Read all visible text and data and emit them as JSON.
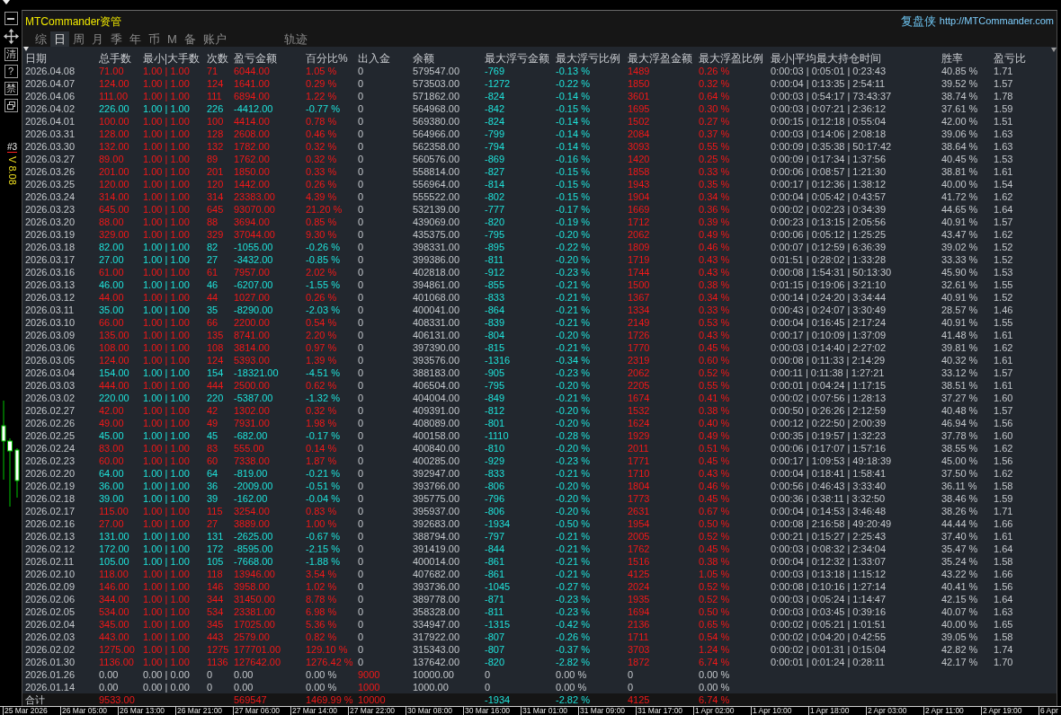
{
  "title": "MTCommander资管",
  "brand": {
    "name": "复盘侠",
    "url": "http://MTCommander.com"
  },
  "toolbar": [
    {
      "kind": "minimize"
    },
    {
      "kind": "move"
    },
    {
      "kind": "text",
      "label": "清"
    },
    {
      "kind": "text",
      "label": "?"
    },
    {
      "kind": "text",
      "label": "禁"
    },
    {
      "kind": "restore"
    }
  ],
  "chart_overlay": {
    "tag": "#3",
    "version": "V 8.08"
  },
  "tabs": [
    {
      "label": "综",
      "selected": false
    },
    {
      "label": "日",
      "selected": true
    },
    {
      "label": "周",
      "selected": false
    },
    {
      "label": "月",
      "selected": false
    },
    {
      "label": "季",
      "selected": false
    },
    {
      "label": "年",
      "selected": false
    },
    {
      "label": "币",
      "selected": false
    },
    {
      "label": "M",
      "selected": false
    },
    {
      "label": "备",
      "selected": false
    },
    {
      "label": "账户",
      "selected": false
    }
  ],
  "trail_button": {
    "label": "轨迹"
  },
  "table": {
    "columns": [
      {
        "label": "日期",
        "kind": "plain"
      },
      {
        "label": "总手数",
        "kind": "outcome"
      },
      {
        "label": "最小|大手数",
        "kind": "outcome"
      },
      {
        "label": "次数",
        "kind": "outcome"
      },
      {
        "label": "盈亏金额",
        "kind": "outcome"
      },
      {
        "label": "百分比%",
        "kind": "outcome"
      },
      {
        "label": "出入金",
        "kind": "cash"
      },
      {
        "label": "余额",
        "kind": "plain"
      },
      {
        "label": "最大浮亏金额",
        "kind": "adverse"
      },
      {
        "label": "最大浮亏比例",
        "kind": "adverse"
      },
      {
        "label": "最大浮盈金额",
        "kind": "favorable"
      },
      {
        "label": "最大浮盈比例",
        "kind": "favorable"
      },
      {
        "label": "最小|平均最大持仓时间",
        "kind": "plain"
      },
      {
        "label": "胜率",
        "kind": "plain"
      },
      {
        "label": "盈亏比",
        "kind": "plain"
      }
    ],
    "rows": [
      {
        "kind": "profit",
        "cash_flow": false,
        "cells": [
          "2026.04.08",
          "71.00",
          "1.00 | 1.00",
          "71",
          "6044.00",
          "1.05 %",
          "0",
          "579547.00",
          "-769",
          "-0.13 %",
          "1489",
          "0.26 %",
          "0:00:03 | 0:05:01 | 0:23:43",
          "40.85 %",
          "1.71"
        ]
      },
      {
        "kind": "profit",
        "cash_flow": false,
        "cells": [
          "2026.04.07",
          "124.00",
          "1.00 | 1.00",
          "124",
          "1641.00",
          "0.29 %",
          "0",
          "573503.00",
          "-1272",
          "-0.22 %",
          "1850",
          "0.32 %",
          "0:00:04 | 0:13:35 | 2:54:11",
          "39.52 %",
          "1.57"
        ]
      },
      {
        "kind": "profit",
        "cash_flow": false,
        "cells": [
          "2026.04.06",
          "111.00",
          "1.00 | 1.00",
          "111",
          "6894.00",
          "1.22 %",
          "0",
          "571862.00",
          "-824",
          "-0.14 %",
          "3601",
          "0.64 %",
          "0:00:03 | 0:54:17 | 73:43:37",
          "38.74 %",
          "1.78"
        ]
      },
      {
        "kind": "loss",
        "cash_flow": false,
        "cells": [
          "2026.04.02",
          "226.00",
          "1.00 | 1.00",
          "226",
          "-4412.00",
          "-0.77 %",
          "0",
          "564968.00",
          "-842",
          "-0.15 %",
          "1695",
          "0.30 %",
          "0:00:03 | 0:07:21 | 2:36:12",
          "37.61 %",
          "1.59"
        ]
      },
      {
        "kind": "profit",
        "cash_flow": false,
        "cells": [
          "2026.04.01",
          "100.00",
          "1.00 | 1.00",
          "100",
          "4414.00",
          "0.78 %",
          "0",
          "569380.00",
          "-824",
          "-0.14 %",
          "1502",
          "0.27 %",
          "0:00:15 | 0:12:18 | 0:55:04",
          "42.00 %",
          "1.51"
        ]
      },
      {
        "kind": "profit",
        "cash_flow": false,
        "cells": [
          "2026.03.31",
          "128.00",
          "1.00 | 1.00",
          "128",
          "2608.00",
          "0.46 %",
          "0",
          "564966.00",
          "-799",
          "-0.14 %",
          "2084",
          "0.37 %",
          "0:00:03 | 0:14:06 | 2:08:18",
          "39.06 %",
          "1.63"
        ]
      },
      {
        "kind": "profit",
        "cash_flow": false,
        "cells": [
          "2026.03.30",
          "132.00",
          "1.00 | 1.00",
          "132",
          "1782.00",
          "0.32 %",
          "0",
          "562358.00",
          "-794",
          "-0.14 %",
          "3093",
          "0.55 %",
          "0:00:09 | 0:35:38 | 50:17:42",
          "38.64 %",
          "1.63"
        ]
      },
      {
        "kind": "profit",
        "cash_flow": false,
        "cells": [
          "2026.03.27",
          "89.00",
          "1.00 | 1.00",
          "89",
          "1762.00",
          "0.32 %",
          "0",
          "560576.00",
          "-869",
          "-0.16 %",
          "1420",
          "0.25 %",
          "0:00:09 | 0:17:34 | 1:37:56",
          "40.45 %",
          "1.53"
        ]
      },
      {
        "kind": "profit",
        "cash_flow": false,
        "cells": [
          "2026.03.26",
          "201.00",
          "1.00 | 1.00",
          "201",
          "1850.00",
          "0.33 %",
          "0",
          "558814.00",
          "-827",
          "-0.15 %",
          "1858",
          "0.33 %",
          "0:00:06 | 0:08:57 | 1:21:30",
          "38.81 %",
          "1.61"
        ]
      },
      {
        "kind": "profit",
        "cash_flow": false,
        "cells": [
          "2026.03.25",
          "120.00",
          "1.00 | 1.00",
          "120",
          "1442.00",
          "0.26 %",
          "0",
          "556964.00",
          "-814",
          "-0.15 %",
          "1943",
          "0.35 %",
          "0:00:17 | 0:12:36 | 1:38:12",
          "40.00 %",
          "1.54"
        ]
      },
      {
        "kind": "profit",
        "cash_flow": false,
        "cells": [
          "2026.03.24",
          "314.00",
          "1.00 | 1.00",
          "314",
          "23383.00",
          "4.39 %",
          "0",
          "555522.00",
          "-802",
          "-0.15 %",
          "1904",
          "0.34 %",
          "0:00:04 | 0:05:42 | 0:43:57",
          "41.72 %",
          "1.62"
        ]
      },
      {
        "kind": "profit",
        "cash_flow": false,
        "cells": [
          "2026.03.23",
          "645.00",
          "1.00 | 1.00",
          "645",
          "93070.00",
          "21.20 %",
          "0",
          "532139.00",
          "-777",
          "-0.17 %",
          "1669",
          "0.36 %",
          "0:00:02 | 0:02:23 | 0:34:39",
          "44.65 %",
          "1.64"
        ]
      },
      {
        "kind": "profit",
        "cash_flow": false,
        "cells": [
          "2026.03.20",
          "88.00",
          "1.00 | 1.00",
          "88",
          "3694.00",
          "0.85 %",
          "0",
          "439069.00",
          "-820",
          "-0.19 %",
          "1712",
          "0.39 %",
          "0:00:23 | 0:13:15 | 2:05:56",
          "40.91 %",
          "1.57"
        ]
      },
      {
        "kind": "profit",
        "cash_flow": false,
        "cells": [
          "2026.03.19",
          "329.00",
          "1.00 | 1.00",
          "329",
          "37044.00",
          "9.30 %",
          "0",
          "435375.00",
          "-795",
          "-0.20 %",
          "2062",
          "0.49 %",
          "0:00:06 | 0:05:12 | 1:25:25",
          "43.47 %",
          "1.62"
        ]
      },
      {
        "kind": "loss",
        "cash_flow": false,
        "cells": [
          "2026.03.18",
          "82.00",
          "1.00 | 1.00",
          "82",
          "-1055.00",
          "-0.26 %",
          "0",
          "398331.00",
          "-895",
          "-0.22 %",
          "1809",
          "0.46 %",
          "0:00:07 | 0:12:59 | 6:36:39",
          "39.02 %",
          "1.52"
        ]
      },
      {
        "kind": "loss",
        "cash_flow": false,
        "cells": [
          "2026.03.17",
          "27.00",
          "1.00 | 1.00",
          "27",
          "-3432.00",
          "-0.85 %",
          "0",
          "399386.00",
          "-811",
          "-0.20 %",
          "1719",
          "0.43 %",
          "0:01:51 | 0:28:02 | 1:33:28",
          "33.33 %",
          "1.52"
        ]
      },
      {
        "kind": "profit",
        "cash_flow": false,
        "cells": [
          "2026.03.16",
          "61.00",
          "1.00 | 1.00",
          "61",
          "7957.00",
          "2.02 %",
          "0",
          "402818.00",
          "-912",
          "-0.23 %",
          "1744",
          "0.43 %",
          "0:00:08 | 1:54:31 | 50:13:30",
          "45.90 %",
          "1.53"
        ]
      },
      {
        "kind": "loss",
        "cash_flow": false,
        "cells": [
          "2026.03.13",
          "46.00",
          "1.00 | 1.00",
          "46",
          "-6207.00",
          "-1.55 %",
          "0",
          "394861.00",
          "-855",
          "-0.21 %",
          "1500",
          "0.38 %",
          "0:01:15 | 0:19:06 | 3:21:10",
          "32.61 %",
          "1.55"
        ]
      },
      {
        "kind": "profit",
        "cash_flow": false,
        "cells": [
          "2026.03.12",
          "44.00",
          "1.00 | 1.00",
          "44",
          "1027.00",
          "0.26 %",
          "0",
          "401068.00",
          "-833",
          "-0.21 %",
          "1367",
          "0.34 %",
          "0:00:14 | 0:24:20 | 3:34:44",
          "40.91 %",
          "1.52"
        ]
      },
      {
        "kind": "loss",
        "cash_flow": false,
        "cells": [
          "2026.03.11",
          "35.00",
          "1.00 | 1.00",
          "35",
          "-8290.00",
          "-2.03 %",
          "0",
          "400041.00",
          "-864",
          "-0.21 %",
          "1334",
          "0.33 %",
          "0:00:43 | 0:24:07 | 3:30:49",
          "28.57 %",
          "1.46"
        ]
      },
      {
        "kind": "profit",
        "cash_flow": false,
        "cells": [
          "2026.03.10",
          "66.00",
          "1.00 | 1.00",
          "66",
          "2200.00",
          "0.54 %",
          "0",
          "408331.00",
          "-839",
          "-0.21 %",
          "2149",
          "0.53 %",
          "0:00:04 | 0:16:45 | 2:17:24",
          "40.91 %",
          "1.55"
        ]
      },
      {
        "kind": "profit",
        "cash_flow": false,
        "cells": [
          "2026.03.09",
          "135.00",
          "1.00 | 1.00",
          "135",
          "8741.00",
          "2.20 %",
          "0",
          "406131.00",
          "-804",
          "-0.20 %",
          "1726",
          "0.43 %",
          "0:00:17 | 0:10:09 | 1:37:09",
          "41.48 %",
          "1.61"
        ]
      },
      {
        "kind": "profit",
        "cash_flow": false,
        "cells": [
          "2026.03.06",
          "108.00",
          "1.00 | 1.00",
          "108",
          "3814.00",
          "0.97 %",
          "0",
          "397390.00",
          "-815",
          "-0.21 %",
          "1770",
          "0.45 %",
          "0:00:03 | 0:14:40 | 2:27:02",
          "39.81 %",
          "1.62"
        ]
      },
      {
        "kind": "profit",
        "cash_flow": false,
        "cells": [
          "2026.03.05",
          "124.00",
          "1.00 | 1.00",
          "124",
          "5393.00",
          "1.39 %",
          "0",
          "393576.00",
          "-1316",
          "-0.34 %",
          "2319",
          "0.60 %",
          "0:00:08 | 0:11:33 | 2:14:29",
          "40.32 %",
          "1.61"
        ]
      },
      {
        "kind": "loss",
        "cash_flow": false,
        "cells": [
          "2026.03.04",
          "154.00",
          "1.00 | 1.00",
          "154",
          "-18321.00",
          "-4.51 %",
          "0",
          "388183.00",
          "-905",
          "-0.23 %",
          "2062",
          "0.52 %",
          "0:00:11 | 0:11:38 | 1:27:21",
          "33.12 %",
          "1.57"
        ]
      },
      {
        "kind": "profit",
        "cash_flow": false,
        "cells": [
          "2026.03.03",
          "444.00",
          "1.00 | 1.00",
          "444",
          "2500.00",
          "0.62 %",
          "0",
          "406504.00",
          "-795",
          "-0.20 %",
          "2205",
          "0.55 %",
          "0:00:01 | 0:04:24 | 1:17:15",
          "38.51 %",
          "1.61"
        ]
      },
      {
        "kind": "loss",
        "cash_flow": false,
        "cells": [
          "2026.03.02",
          "220.00",
          "1.00 | 1.00",
          "220",
          "-5387.00",
          "-1.32 %",
          "0",
          "404004.00",
          "-849",
          "-0.21 %",
          "1674",
          "0.41 %",
          "0:00:02 | 0:07:56 | 1:28:13",
          "37.27 %",
          "1.60"
        ]
      },
      {
        "kind": "profit",
        "cash_flow": false,
        "cells": [
          "2026.02.27",
          "42.00",
          "1.00 | 1.00",
          "42",
          "1302.00",
          "0.32 %",
          "0",
          "409391.00",
          "-812",
          "-0.20 %",
          "1532",
          "0.38 %",
          "0:00:50 | 0:26:26 | 2:12:59",
          "40.48 %",
          "1.57"
        ]
      },
      {
        "kind": "profit",
        "cash_flow": false,
        "cells": [
          "2026.02.26",
          "49.00",
          "1.00 | 1.00",
          "49",
          "7931.00",
          "1.98 %",
          "0",
          "408089.00",
          "-801",
          "-0.20 %",
          "1624",
          "0.40 %",
          "0:00:12 | 0:22:50 | 2:00:39",
          "46.94 %",
          "1.56"
        ]
      },
      {
        "kind": "loss",
        "cash_flow": false,
        "cells": [
          "2026.02.25",
          "45.00",
          "1.00 | 1.00",
          "45",
          "-682.00",
          "-0.17 %",
          "0",
          "400158.00",
          "-1110",
          "-0.28 %",
          "1929",
          "0.49 %",
          "0:00:35 | 0:19:57 | 1:32:23",
          "37.78 %",
          "1.60"
        ]
      },
      {
        "kind": "profit",
        "cash_flow": false,
        "cells": [
          "2026.02.24",
          "83.00",
          "1.00 | 1.00",
          "83",
          "555.00",
          "0.14 %",
          "0",
          "400840.00",
          "-810",
          "-0.20 %",
          "2011",
          "0.51 %",
          "0:00:06 | 0:17:07 | 1:57:16",
          "38.55 %",
          "1.62"
        ]
      },
      {
        "kind": "profit",
        "cash_flow": false,
        "cells": [
          "2026.02.23",
          "60.00",
          "1.00 | 1.00",
          "60",
          "7338.00",
          "1.87 %",
          "0",
          "400285.00",
          "-929",
          "-0.23 %",
          "1771",
          "0.45 %",
          "0:00:17 | 1:09:53 | 49:18:39",
          "45.00 %",
          "1.56"
        ]
      },
      {
        "kind": "loss",
        "cash_flow": false,
        "cells": [
          "2026.02.20",
          "64.00",
          "1.00 | 1.00",
          "64",
          "-819.00",
          "-0.21 %",
          "0",
          "392947.00",
          "-833",
          "-0.21 %",
          "1710",
          "0.43 %",
          "0:00:04 | 0:18:41 | 1:58:41",
          "37.50 %",
          "1.62"
        ]
      },
      {
        "kind": "loss",
        "cash_flow": false,
        "cells": [
          "2026.02.19",
          "36.00",
          "1.00 | 1.00",
          "36",
          "-2009.00",
          "-0.51 %",
          "0",
          "393766.00",
          "-806",
          "-0.20 %",
          "1804",
          "0.46 %",
          "0:00:56 | 0:46:43 | 3:33:40",
          "36.11 %",
          "1.58"
        ]
      },
      {
        "kind": "loss",
        "cash_flow": false,
        "cells": [
          "2026.02.18",
          "39.00",
          "1.00 | 1.00",
          "39",
          "-162.00",
          "-0.04 %",
          "0",
          "395775.00",
          "-796",
          "-0.20 %",
          "1773",
          "0.45 %",
          "0:00:36 | 0:38:11 | 3:32:50",
          "38.46 %",
          "1.59"
        ]
      },
      {
        "kind": "profit",
        "cash_flow": false,
        "cells": [
          "2026.02.17",
          "115.00",
          "1.00 | 1.00",
          "115",
          "3254.00",
          "0.83 %",
          "0",
          "395937.00",
          "-806",
          "-0.20 %",
          "2631",
          "0.67 %",
          "0:00:04 | 0:14:53 | 3:46:48",
          "38.26 %",
          "1.71"
        ]
      },
      {
        "kind": "profit",
        "cash_flow": false,
        "cells": [
          "2026.02.16",
          "27.00",
          "1.00 | 1.00",
          "27",
          "3889.00",
          "1.00 %",
          "0",
          "392683.00",
          "-1934",
          "-0.50 %",
          "1954",
          "0.50 %",
          "0:00:08 | 2:16:58 | 49:20:49",
          "44.44 %",
          "1.66"
        ]
      },
      {
        "kind": "loss",
        "cash_flow": false,
        "cells": [
          "2026.02.13",
          "131.00",
          "1.00 | 1.00",
          "131",
          "-2625.00",
          "-0.67 %",
          "0",
          "388794.00",
          "-797",
          "-0.21 %",
          "2005",
          "0.52 %",
          "0:00:21 | 0:15:27 | 2:25:43",
          "37.40 %",
          "1.61"
        ]
      },
      {
        "kind": "loss",
        "cash_flow": false,
        "cells": [
          "2026.02.12",
          "172.00",
          "1.00 | 1.00",
          "172",
          "-8595.00",
          "-2.15 %",
          "0",
          "391419.00",
          "-844",
          "-0.21 %",
          "1762",
          "0.45 %",
          "0:00:03 | 0:08:32 | 2:34:04",
          "35.47 %",
          "1.64"
        ]
      },
      {
        "kind": "loss",
        "cash_flow": false,
        "cells": [
          "2026.02.11",
          "105.00",
          "1.00 | 1.00",
          "105",
          "-7668.00",
          "-1.88 %",
          "0",
          "400014.00",
          "-861",
          "-0.21 %",
          "1516",
          "0.38 %",
          "0:00:04 | 0:12:32 | 1:33:07",
          "35.24 %",
          "1.58"
        ]
      },
      {
        "kind": "profit",
        "cash_flow": false,
        "cells": [
          "2026.02.10",
          "118.00",
          "1.00 | 1.00",
          "118",
          "13946.00",
          "3.54 %",
          "0",
          "407682.00",
          "-861",
          "-0.21 %",
          "4125",
          "1.05 %",
          "0:00:03 | 0:13:18 | 1:15:12",
          "43.22 %",
          "1.66"
        ]
      },
      {
        "kind": "profit",
        "cash_flow": false,
        "cells": [
          "2026.02.09",
          "146.00",
          "1.00 | 1.00",
          "146",
          "3958.00",
          "1.02 %",
          "0",
          "393736.00",
          "-1045",
          "-0.27 %",
          "2024",
          "0.52 %",
          "0:00:08 | 0:10:16 | 1:27:14",
          "40.41 %",
          "1.56"
        ]
      },
      {
        "kind": "profit",
        "cash_flow": false,
        "cells": [
          "2026.02.06",
          "344.00",
          "1.00 | 1.00",
          "344",
          "31450.00",
          "8.78 %",
          "0",
          "389778.00",
          "-871",
          "-0.23 %",
          "1935",
          "0.52 %",
          "0:00:03 | 0:05:24 | 1:14:47",
          "42.15 %",
          "1.64"
        ]
      },
      {
        "kind": "profit",
        "cash_flow": false,
        "cells": [
          "2026.02.05",
          "534.00",
          "1.00 | 1.00",
          "534",
          "23381.00",
          "6.98 %",
          "0",
          "358328.00",
          "-811",
          "-0.23 %",
          "1694",
          "0.50 %",
          "0:00:03 | 0:03:45 | 0:39:16",
          "40.07 %",
          "1.63"
        ]
      },
      {
        "kind": "profit",
        "cash_flow": false,
        "cells": [
          "2026.02.04",
          "345.00",
          "1.00 | 1.00",
          "345",
          "17025.00",
          "5.36 %",
          "0",
          "334947.00",
          "-1315",
          "-0.42 %",
          "2136",
          "0.65 %",
          "0:00:02 | 0:05:21 | 1:01:51",
          "40.00 %",
          "1.65"
        ]
      },
      {
        "kind": "profit",
        "cash_flow": false,
        "cells": [
          "2026.02.03",
          "443.00",
          "1.00 | 1.00",
          "443",
          "2579.00",
          "0.82 %",
          "0",
          "317922.00",
          "-807",
          "-0.26 %",
          "1711",
          "0.54 %",
          "0:00:02 | 0:04:20 | 0:42:55",
          "39.05 %",
          "1.58"
        ]
      },
      {
        "kind": "profit",
        "cash_flow": false,
        "cells": [
          "2026.02.02",
          "1275.00",
          "1.00 | 1.00",
          "1275",
          "177701.00",
          "129.10 %",
          "0",
          "315343.00",
          "-807",
          "-0.37 %",
          "3703",
          "1.24 %",
          "0:00:02 | 0:01:31 | 0:15:04",
          "42.82 %",
          "1.74"
        ]
      },
      {
        "kind": "profit",
        "cash_flow": false,
        "cells": [
          "2026.01.30",
          "1136.00",
          "1.00 | 1.00",
          "1136",
          "127642.00",
          "1276.42 %",
          "0",
          "137642.00",
          "-820",
          "-2.82 %",
          "1872",
          "6.74 %",
          "0:00:01 | 0:01:24 | 0:28:11",
          "42.17 %",
          "1.70"
        ]
      },
      {
        "kind": "flat",
        "cash_flow": true,
        "cells": [
          "2026.01.26",
          "0.00",
          "0.00 | 0.00",
          "0",
          "0.00",
          "0.00 %",
          "9000",
          "10000.00",
          "0",
          "0.00 %",
          "0",
          "0.00 %",
          null,
          null,
          null
        ]
      },
      {
        "kind": "flat",
        "cash_flow": true,
        "cells": [
          "2026.01.14",
          "0.00",
          "0.00 | 0.00",
          "0",
          "0.00",
          "0.00 %",
          "1000",
          "1000.00",
          "0",
          "0.00 %",
          "0",
          "0.00 %",
          null,
          null,
          null
        ]
      }
    ],
    "total": {
      "kind": "profit",
      "cash_flow": true,
      "cells": [
        "合计",
        "9533.00",
        null,
        null,
        "569547",
        "1469.99 %",
        "10000",
        null,
        "-1934",
        "-2.82 %",
        "4125",
        "6.74 %",
        null,
        null,
        null
      ]
    }
  },
  "time_axis": {
    "labels": [
      "25 Mar 2026",
      "26 Mar 05:00",
      "26 Mar 13:00",
      "26 Mar 21:00",
      "27 Mar 06:00",
      "27 Mar 14:00",
      "27 Mar 22:00",
      "30 Mar 08:00",
      "30 Mar 16:00",
      "31 Mar 01:00",
      "31 Mar 09:00",
      "31 Mar 17:00",
      "1 Apr 02:00",
      "1 Apr 10:00",
      "1 Apr 18:00",
      "2 Apr 03:00",
      "2 Apr 11:00",
      "2 Apr 19:00",
      "6 Apr"
    ]
  }
}
